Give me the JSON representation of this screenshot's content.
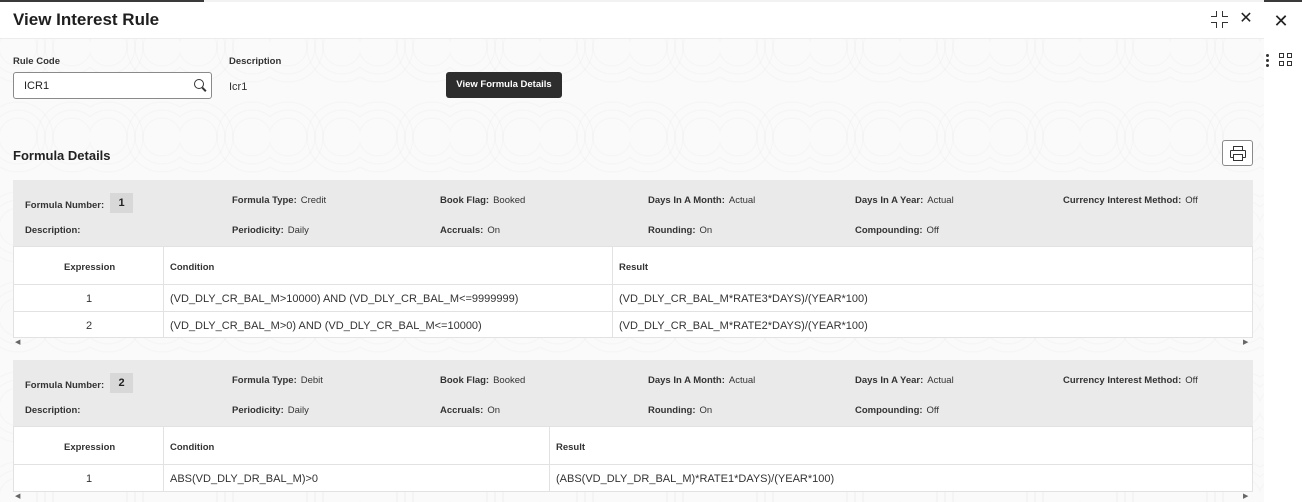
{
  "app": {
    "title": "View Interest Rule",
    "close_symbol": "✕",
    "outer_close_symbol": "✕"
  },
  "form": {
    "rule_code_label": "Rule Code",
    "rule_code_value": "ICR1",
    "description_label": "Description",
    "description_value": "Icr1",
    "view_formula_button": "View Formula Details"
  },
  "section": {
    "title": "Formula Details"
  },
  "labels": {
    "formula_number": "Formula Number:",
    "formula_type": "Formula Type:",
    "book_flag": "Book Flag:",
    "days_in_month": "Days In A Month:",
    "days_in_year": "Days In A Year:",
    "currency_interest_method": "Currency Interest Method:",
    "description": "Description:",
    "periodicity": "Periodicity:",
    "accruals": "Accruals:",
    "rounding": "Rounding:",
    "compounding": "Compounding:",
    "col_expression": "Expression",
    "col_condition": "Condition",
    "col_result": "Result"
  },
  "formulas": [
    {
      "number": "1",
      "type": "Credit",
      "book_flag": "Booked",
      "days_in_month": "Actual",
      "days_in_year": "Actual",
      "currency_interest_method": "Off",
      "description": "",
      "periodicity": "Daily",
      "accruals": "On",
      "rounding": "On",
      "compounding": "Off",
      "rows": [
        {
          "expression": "1",
          "condition": "(VD_DLY_CR_BAL_M>10000) AND (VD_DLY_CR_BAL_M<=9999999)",
          "result": "(VD_DLY_CR_BAL_M*RATE3*DAYS)/(YEAR*100)"
        },
        {
          "expression": "2",
          "condition": "(VD_DLY_CR_BAL_M>0) AND (VD_DLY_CR_BAL_M<=10000)",
          "result": "(VD_DLY_CR_BAL_M*RATE2*DAYS)/(YEAR*100)"
        }
      ]
    },
    {
      "number": "2",
      "type": "Debit",
      "book_flag": "Booked",
      "days_in_month": "Actual",
      "days_in_year": "Actual",
      "currency_interest_method": "Off",
      "description": "",
      "periodicity": "Daily",
      "accruals": "On",
      "rounding": "On",
      "compounding": "Off",
      "rows": [
        {
          "expression": "1",
          "condition": "ABS(VD_DLY_DR_BAL_M)>0",
          "result": "(ABS(VD_DLY_DR_BAL_M)*RATE1*DAYS)/(YEAR*100)"
        }
      ]
    }
  ],
  "icons": {
    "search": "search-icon",
    "print": "print-icon",
    "collapse": "collapse-icon",
    "close": "close-icon",
    "kebab": "kebab-menu-icon",
    "grid": "grid-view-icon"
  },
  "colors": {
    "primary_button": "#2d2d2d",
    "block_bg": "#eaeaea"
  }
}
